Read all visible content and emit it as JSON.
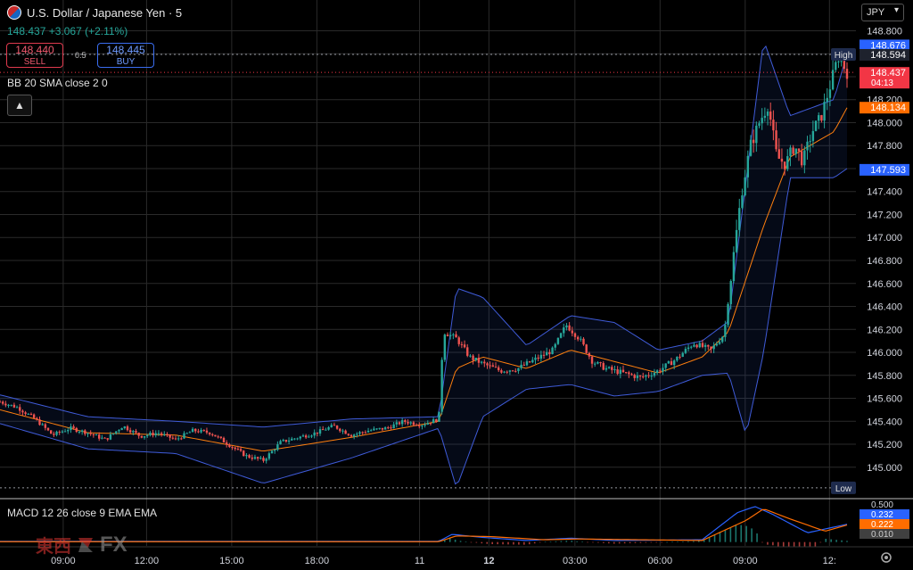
{
  "header": {
    "symbol_title": "U.S. Dollar / Japanese Yen · 5",
    "change_text": "148.437  +3.067 (+2.11%)",
    "sell_price": "148.440",
    "sell_label": "SELL",
    "buy_price": "148.445",
    "buy_label": "BUY",
    "spread": "0.5",
    "currency_select": "JPY",
    "collapse_icon": "▲"
  },
  "indicators": {
    "bb_label": "BB 20 SMA close 2 0",
    "macd_label": "MACD 12 26 close 9 EMA EMA"
  },
  "watermark": {
    "text_kanji": "東西",
    "text_fx": "FX"
  },
  "colors": {
    "up": "#26a69a",
    "down": "#ef5350",
    "bb_band": "#3f5bd8",
    "bb_basis": "#ff7f0e",
    "macd_line": "#2962ff",
    "signal_line": "#ff6d00",
    "grid": "#2a2a2a",
    "axis_text": "#d1d4dc"
  },
  "chart_data": {
    "type": "candlestick",
    "title": "U.S. Dollar / Japanese Yen · 5",
    "y_axis": {
      "ticks": [
        "148.800",
        "148.600",
        "148.400",
        "148.200",
        "148.000",
        "147.800",
        "147.600",
        "147.400",
        "147.200",
        "147.000",
        "146.800",
        "146.600",
        "146.400",
        "146.200",
        "146.000",
        "145.800",
        "145.600",
        "145.400",
        "145.200",
        "145.000"
      ],
      "ylim": [
        144.75,
        148.85
      ]
    },
    "x_axis": {
      "ticks": [
        "09:00",
        "12:00",
        "15:00",
        "18:00",
        "11",
        "12",
        "03:00",
        "06:00",
        "09:00",
        "12:"
      ]
    },
    "price_markers": [
      {
        "label": "High",
        "value": 148.594
      },
      {
        "label": "Low",
        "value": 144.821
      }
    ],
    "axis_badges": [
      {
        "text": "148.676",
        "color": "#2962ff",
        "value": 148.676
      },
      {
        "text": "148.594",
        "color": "#1e222d",
        "value": 148.594
      },
      {
        "text": "148.437",
        "sub": "04:13",
        "color": "#f23645",
        "value": 148.437
      },
      {
        "text": "148.134",
        "color": "#ff6d00",
        "value": 148.134
      },
      {
        "text": "147.593",
        "color": "#2962ff",
        "value": 147.593
      }
    ],
    "close_path": [
      [
        0,
        145.57
      ],
      [
        0.02,
        145.52
      ],
      [
        0.04,
        145.42
      ],
      [
        0.06,
        145.28
      ],
      [
        0.08,
        145.34
      ],
      [
        0.1,
        145.3
      ],
      [
        0.12,
        145.24
      ],
      [
        0.14,
        145.36
      ],
      [
        0.16,
        145.27
      ],
      [
        0.18,
        145.3
      ],
      [
        0.2,
        145.24
      ],
      [
        0.22,
        145.32
      ],
      [
        0.24,
        145.3
      ],
      [
        0.26,
        145.2
      ],
      [
        0.28,
        145.1
      ],
      [
        0.3,
        145.06
      ],
      [
        0.32,
        145.22
      ],
      [
        0.34,
        145.26
      ],
      [
        0.36,
        145.3
      ],
      [
        0.38,
        145.36
      ],
      [
        0.4,
        145.28
      ],
      [
        0.42,
        145.32
      ],
      [
        0.44,
        145.34
      ],
      [
        0.46,
        145.4
      ],
      [
        0.48,
        145.37
      ],
      [
        0.5,
        145.42
      ],
      [
        0.505,
        146.18
      ],
      [
        0.52,
        146.12
      ],
      [
        0.535,
        145.96
      ],
      [
        0.55,
        145.9
      ],
      [
        0.57,
        145.84
      ],
      [
        0.59,
        145.86
      ],
      [
        0.61,
        145.94
      ],
      [
        0.63,
        146.02
      ],
      [
        0.645,
        146.24
      ],
      [
        0.66,
        146.12
      ],
      [
        0.675,
        145.92
      ],
      [
        0.69,
        145.86
      ],
      [
        0.71,
        145.82
      ],
      [
        0.73,
        145.78
      ],
      [
        0.75,
        145.84
      ],
      [
        0.77,
        145.94
      ],
      [
        0.79,
        146.08
      ],
      [
        0.81,
        146.02
      ],
      [
        0.825,
        146.16
      ],
      [
        0.835,
        146.8
      ],
      [
        0.845,
        147.4
      ],
      [
        0.855,
        147.8
      ],
      [
        0.865,
        148.0
      ],
      [
        0.875,
        148.16
      ],
      [
        0.885,
        147.7
      ],
      [
        0.895,
        147.64
      ],
      [
        0.905,
        147.8
      ],
      [
        0.915,
        147.66
      ],
      [
        0.925,
        147.92
      ],
      [
        0.935,
        148.04
      ],
      [
        0.945,
        148.3
      ],
      [
        0.955,
        148.58
      ],
      [
        0.965,
        148.44
      ]
    ],
    "bollinger": {
      "upper": [
        [
          0,
          145.63
        ],
        [
          0.1,
          145.44
        ],
        [
          0.2,
          145.4
        ],
        [
          0.3,
          145.35
        ],
        [
          0.4,
          145.42
        ],
        [
          0.5,
          145.44
        ],
        [
          0.52,
          146.56
        ],
        [
          0.55,
          146.48
        ],
        [
          0.6,
          146.06
        ],
        [
          0.65,
          146.32
        ],
        [
          0.7,
          146.26
        ],
        [
          0.75,
          146.02
        ],
        [
          0.8,
          146.1
        ],
        [
          0.83,
          146.27
        ],
        [
          0.87,
          148.72
        ],
        [
          0.9,
          148.06
        ],
        [
          0.95,
          148.2
        ],
        [
          0.965,
          148.6
        ]
      ],
      "basis": [
        [
          0,
          145.5
        ],
        [
          0.1,
          145.3
        ],
        [
          0.2,
          145.28
        ],
        [
          0.3,
          145.14
        ],
        [
          0.4,
          145.26
        ],
        [
          0.5,
          145.4
        ],
        [
          0.52,
          145.86
        ],
        [
          0.55,
          145.96
        ],
        [
          0.6,
          145.86
        ],
        [
          0.65,
          146.02
        ],
        [
          0.7,
          145.92
        ],
        [
          0.75,
          145.82
        ],
        [
          0.8,
          145.96
        ],
        [
          0.83,
          146.18
        ],
        [
          0.87,
          147.1
        ],
        [
          0.9,
          147.7
        ],
        [
          0.95,
          147.92
        ],
        [
          0.965,
          148.13
        ]
      ],
      "lower": [
        [
          0,
          145.38
        ],
        [
          0.1,
          145.16
        ],
        [
          0.2,
          145.12
        ],
        [
          0.3,
          144.86
        ],
        [
          0.4,
          145.08
        ],
        [
          0.5,
          145.34
        ],
        [
          0.52,
          144.82
        ],
        [
          0.55,
          145.44
        ],
        [
          0.6,
          145.68
        ],
        [
          0.65,
          145.72
        ],
        [
          0.7,
          145.62
        ],
        [
          0.75,
          145.66
        ],
        [
          0.8,
          145.8
        ],
        [
          0.83,
          145.82
        ],
        [
          0.85,
          145.28
        ],
        [
          0.87,
          146.0
        ],
        [
          0.9,
          147.52
        ],
        [
          0.95,
          147.52
        ],
        [
          0.965,
          147.6
        ]
      ]
    },
    "macd": {
      "ylim": [
        -0.05,
        0.55
      ],
      "ticks": [
        "0.500",
        "0.232",
        "0.222",
        "0.010"
      ],
      "macd_line": [
        [
          0,
          0.01
        ],
        [
          0.5,
          0.01
        ],
        [
          0.515,
          0.1
        ],
        [
          0.55,
          0.06
        ],
        [
          0.6,
          0.02
        ],
        [
          0.65,
          0.05
        ],
        [
          0.7,
          0.02
        ],
        [
          0.8,
          0.03
        ],
        [
          0.84,
          0.38
        ],
        [
          0.86,
          0.46
        ],
        [
          0.88,
          0.36
        ],
        [
          0.92,
          0.12
        ],
        [
          0.965,
          0.23
        ]
      ],
      "signal_line": [
        [
          0,
          0.005
        ],
        [
          0.5,
          0.005
        ],
        [
          0.52,
          0.08
        ],
        [
          0.56,
          0.07
        ],
        [
          0.62,
          0.03
        ],
        [
          0.66,
          0.04
        ],
        [
          0.8,
          0.02
        ],
        [
          0.85,
          0.28
        ],
        [
          0.87,
          0.43
        ],
        [
          0.9,
          0.3
        ],
        [
          0.94,
          0.14
        ],
        [
          0.965,
          0.22
        ]
      ],
      "histogram_value": 0.01
    }
  }
}
